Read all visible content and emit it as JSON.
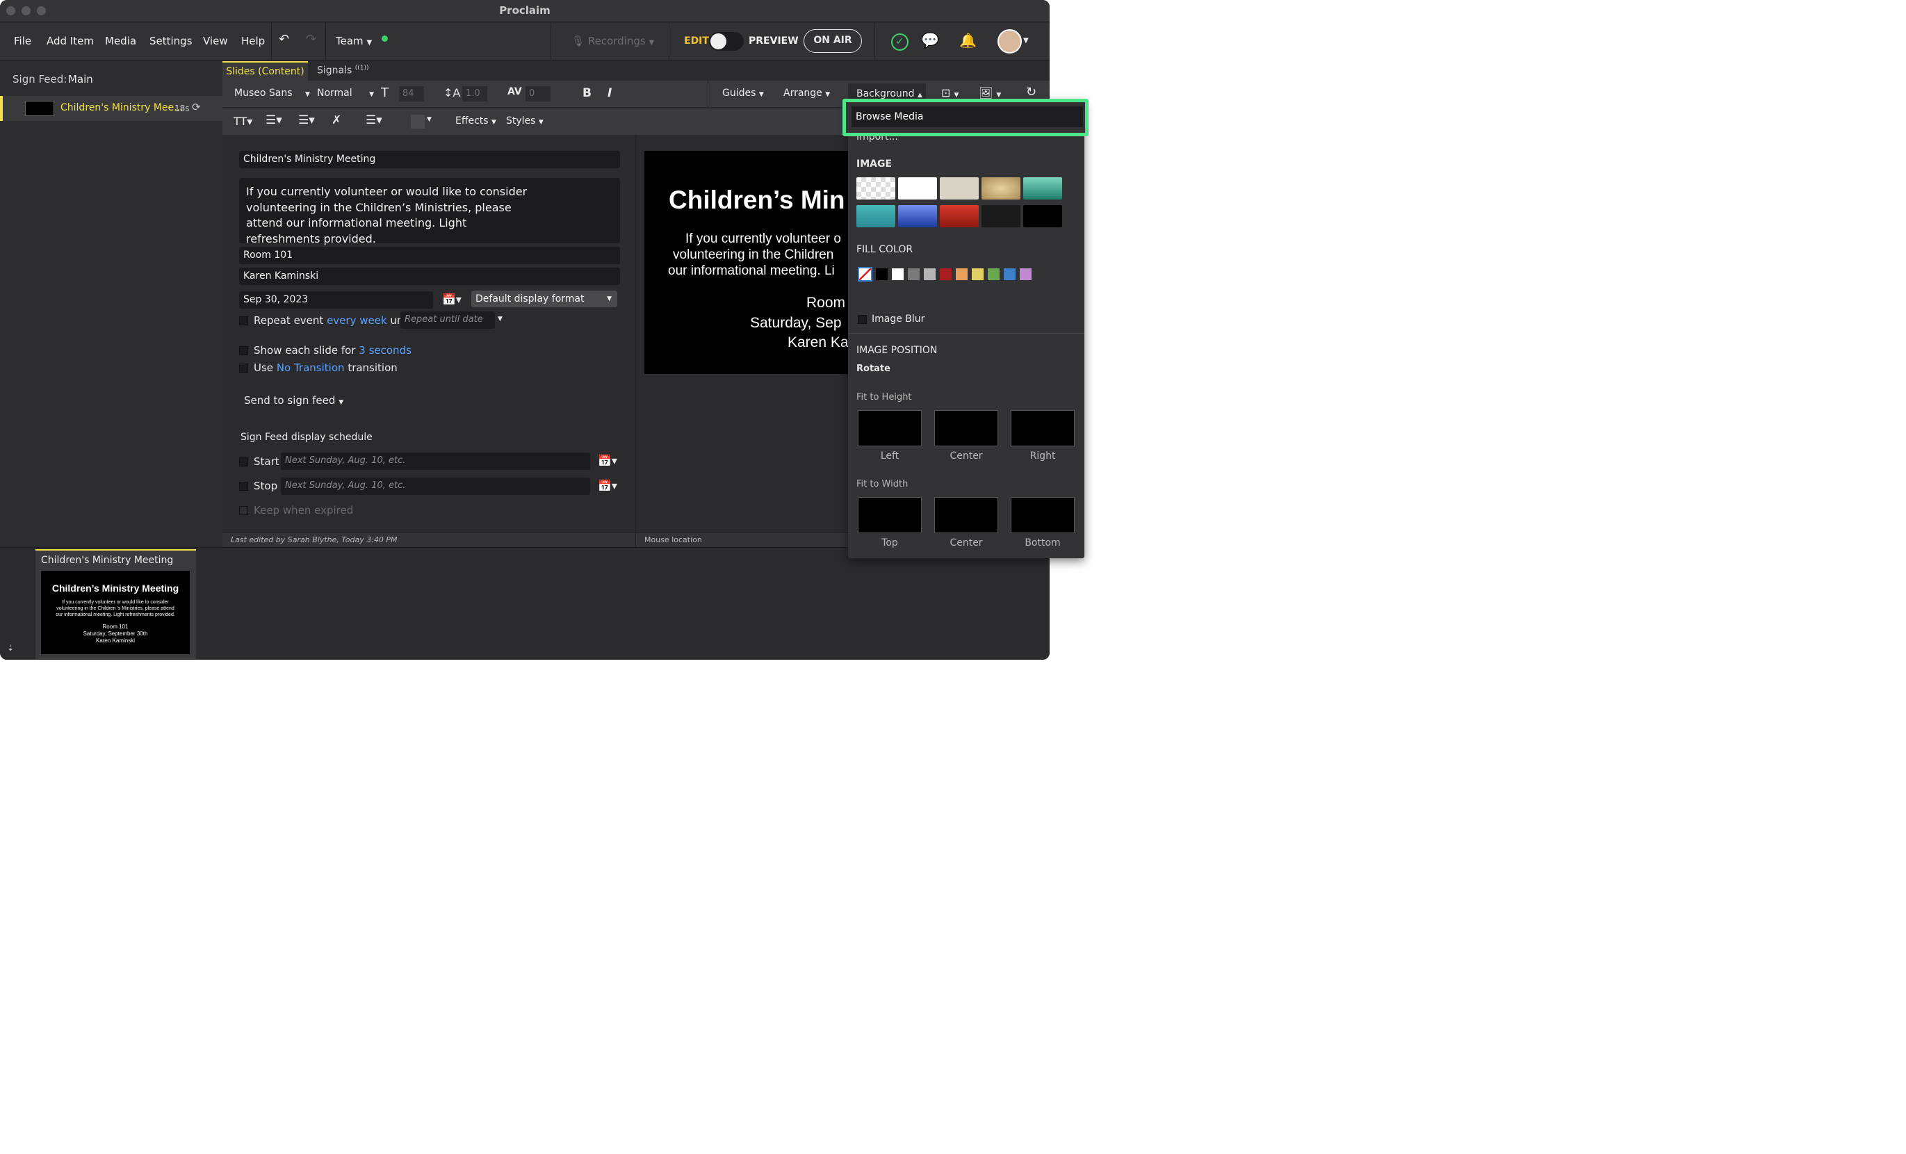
{
  "window": {
    "title": "Proclaim"
  },
  "menu": {
    "items": [
      "File",
      "Add Item",
      "Media",
      "Settings",
      "View",
      "Help"
    ],
    "team": "Team",
    "recordings": "Recordings",
    "edit": "EDIT",
    "preview": "PREVIEW",
    "on_air": "ON AIR"
  },
  "sidebar": {
    "feed_label": "Sign Feed:",
    "feed_name": "Main",
    "item_title": "Children's Ministry Mee...",
    "item_duration": "18s"
  },
  "tabs": {
    "slides": "Slides (Content)",
    "signals": "Signals",
    "signals_badge": "((1))"
  },
  "toolbar": {
    "font": "Museo Sans",
    "weight": "Normal",
    "size": "84",
    "line_height": "1.0",
    "spacing": "0",
    "bold": "B",
    "italic": "I",
    "guides": "Guides",
    "arrange": "Arrange",
    "background": "Background",
    "effects": "Effects",
    "styles": "Styles"
  },
  "form": {
    "title": "Children's Ministry Meeting",
    "body": "If you currently volunteer or would like to consider volunteering in the Children’s Ministries, please attend our informational meeting. Light refreshments provided.",
    "location": "Room 101",
    "contact": "Karen Kaminski",
    "date": "Sep 30, 2023",
    "display_format": "Default display format",
    "repeat_label": "Repeat event",
    "repeat_link": "every week",
    "until": "until",
    "repeat_placeholder": "Repeat until date",
    "show_label": "Show each slide for",
    "show_link": "3 seconds",
    "use_label": "Use",
    "transition_link": "No Transition",
    "transition_label": "transition",
    "send": "Send to sign feed",
    "schedule_heading": "Sign Feed display schedule",
    "start": "Start",
    "stop": "Stop",
    "date_placeholder": "Next Sunday, Aug. 10, etc.",
    "keep": "Keep when expired"
  },
  "status": {
    "last_edited": "Last edited by Sarah Blythe, Today 3:40 PM",
    "mouse": "Mouse location"
  },
  "preview": {
    "title": "Children’s Min",
    "line1": "If you currently volunteer o",
    "line2": "volunteering in the Children",
    "line3": "our informational meeting. Li",
    "room": "Room",
    "date": "Saturday, Sep",
    "name": "Karen Ka"
  },
  "thumbnail": {
    "label": "Children's Ministry Meeting",
    "title": "Children’s Ministry Meeting",
    "body1": "If you currently volunteer or would like to consider",
    "body2": "volunteering in the Children ’s Ministries, please attend",
    "body3": "our informational meeting. Light refreshments provided.",
    "room": "Room 101",
    "date": "Saturday, September 30th",
    "name": "Karen Kaminski"
  },
  "background_menu": {
    "browse": "Browse Media",
    "import": "Import...",
    "image_heading": "IMAGE",
    "fill_heading": "FILL COLOR",
    "image_blur": "Image Blur",
    "position_heading": "IMAGE POSITION",
    "rotate": "Rotate",
    "fit_height": "Fit to Height",
    "fit_width": "Fit to Width",
    "height_options": [
      "Left",
      "Center",
      "Right"
    ],
    "width_options": [
      "Top",
      "Center",
      "Bottom"
    ],
    "fill_colors": [
      "#000000",
      "#ffffff",
      "#7a7a7a",
      "#b5b5b5",
      "#a81d1d",
      "#e9a05a",
      "#e1cf63",
      "#6aa84f",
      "#3d7fc9",
      "#c08ad0"
    ],
    "highlight_color": "#4ee68a"
  }
}
